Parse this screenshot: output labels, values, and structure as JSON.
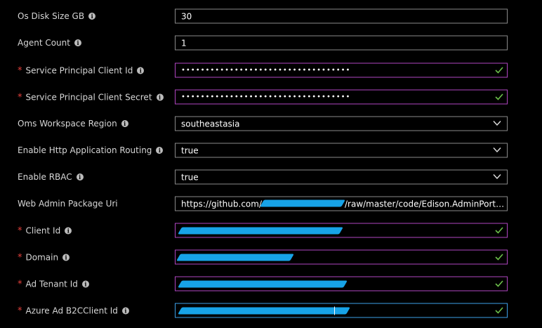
{
  "fields": [
    {
      "label": "Os Disk Size GB",
      "required": false,
      "value": "30",
      "type": "text"
    },
    {
      "label": "Agent Count",
      "required": false,
      "value": "1",
      "type": "text"
    },
    {
      "label": "Service Principal Client Id",
      "required": true,
      "value": "•••••••••••••••••••••••••••••••••••",
      "type": "password"
    },
    {
      "label": "Service Principal Client Secret",
      "required": true,
      "value": "•••••••••••••••••••••••••••••••••••",
      "type": "password"
    },
    {
      "label": "Oms Workspace Region",
      "required": false,
      "value": "southeastasia",
      "type": "select"
    },
    {
      "label": "Enable Http Application Routing",
      "required": false,
      "value": "true",
      "type": "select"
    },
    {
      "label": "Enable RBAC",
      "required": false,
      "value": "true",
      "type": "select"
    },
    {
      "label": "Web Admin Package Uri",
      "required": false,
      "value_prefix": "https://github.com/",
      "value_suffix": "/raw/master/code/Edison.AdminPortal....",
      "type": "text"
    },
    {
      "label": "Client Id",
      "required": true,
      "type": "redacted"
    },
    {
      "label": "Domain",
      "required": true,
      "type": "redacted"
    },
    {
      "label": "Ad Tenant Id",
      "required": true,
      "type": "redacted"
    },
    {
      "label": "Azure Ad B2CClient Id",
      "required": true,
      "type": "redacted"
    }
  ],
  "required_marker": "*",
  "info_glyph": "i",
  "colors": {
    "required": "#e8413c",
    "valid_border": "#b146c2",
    "focus_border": "#3da0e8",
    "check": "#6cc04a",
    "redaction": "#17a3e8"
  },
  "icons": {
    "info": "info-icon",
    "check": "checkmark-icon",
    "dropdown": "chevron-down-icon"
  }
}
